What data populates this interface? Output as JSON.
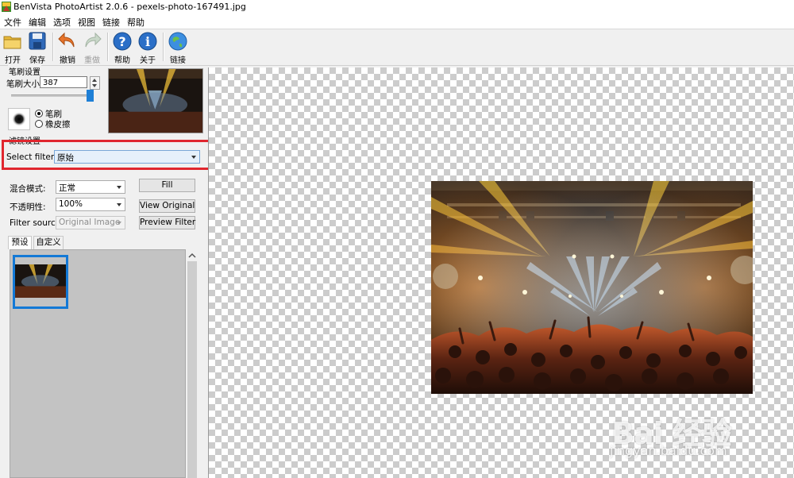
{
  "window": {
    "title": "BenVista PhotoArtist 2.0.6 - pexels-photo-167491.jpg"
  },
  "menu": [
    "文件",
    "编辑",
    "选项",
    "视图",
    "链接",
    "帮助"
  ],
  "toolbar": {
    "open": "打开",
    "save": "保存",
    "undo": "撤销",
    "redo": "重做",
    "help": "帮助",
    "about": "关于",
    "link": "链接"
  },
  "brush_settings": {
    "group_label": "笔刷设置",
    "size_label": "笔刷大小:",
    "size_value": "387",
    "mode_brush": "笔刷",
    "mode_eraser": "橡皮擦",
    "selected_mode": "笔刷"
  },
  "filter_settings": {
    "group_label": "滤镜设置",
    "select_filter_label": "Select filter:",
    "selected_filter": "原始",
    "blend_mode_label": "混合模式:",
    "blend_mode_value": "正常",
    "opacity_label": "不透明性:",
    "opacity_value": "100%",
    "filter_source_label": "Filter source:",
    "filter_source_value": "Original Image",
    "fill_button": "Fill",
    "view_original_button": "View Original",
    "preview_filter_button": "Preview Filter"
  },
  "preset_tabs": [
    {
      "label": "预设",
      "active": true
    },
    {
      "label": "自定义",
      "active": false
    }
  ],
  "watermark": {
    "text": "Bai 经验",
    "url": "jingyan.baidu.com"
  },
  "colors": {
    "highlight_red": "#e0262e",
    "selection_blue": "#1379d6",
    "slider_blue": "#1e7fd6"
  }
}
